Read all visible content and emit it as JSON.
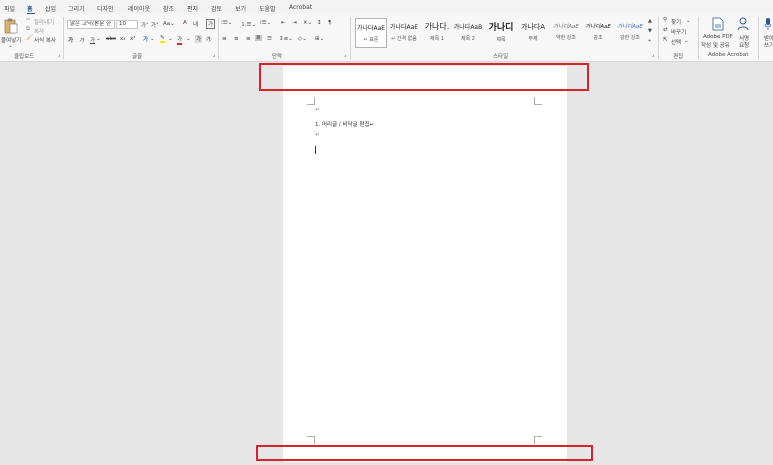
{
  "tabs": [
    "파일",
    "홈",
    "삽입",
    "그리기",
    "디자인",
    "레이아웃",
    "참조",
    "편지",
    "검토",
    "보기",
    "도움말",
    "Acrobat"
  ],
  "clipboard": {
    "paste": "붙여넣기",
    "cut": "잘라내기",
    "copy": "복사",
    "format_painter": "서식 복사",
    "label": "클립보드"
  },
  "font": {
    "name": "맑은 고딕(본문 한",
    "size": "10",
    "label": "글꼴"
  },
  "paragraph": {
    "label": "단락"
  },
  "styles": {
    "label": "스타일",
    "items": [
      {
        "sample": "가나다AaE",
        "name": "↵ 표준"
      },
      {
        "sample": "가나다AaE",
        "name": "↵ 간격 없음"
      },
      {
        "sample": "가나다.",
        "name": "제목 1"
      },
      {
        "sample": "가나다AaB",
        "name": "제목 2"
      },
      {
        "sample": "가나디",
        "name": "제목"
      },
      {
        "sample": "가나다A",
        "name": "부제"
      },
      {
        "sample": "가나다AaE",
        "name": "약한 강조"
      },
      {
        "sample": "가나다AaE",
        "name": "강조"
      },
      {
        "sample": "가나다AaE",
        "name": "강한 강조"
      }
    ]
  },
  "editing": {
    "label": "편집",
    "find": "찾기",
    "replace": "바꾸기",
    "select": "선택"
  },
  "acrobat": {
    "label": "Adobe Acrobat",
    "create_pdf_1": "Adobe PDF",
    "create_pdf_2": "작성 및 공유",
    "sign_1": "서명",
    "sign_2": "요청"
  },
  "extra": {
    "label_1": "받아",
    "label_2": "쓰기"
  },
  "document": {
    "line1": "1. 머리글 / 바닥글 편집↵"
  }
}
